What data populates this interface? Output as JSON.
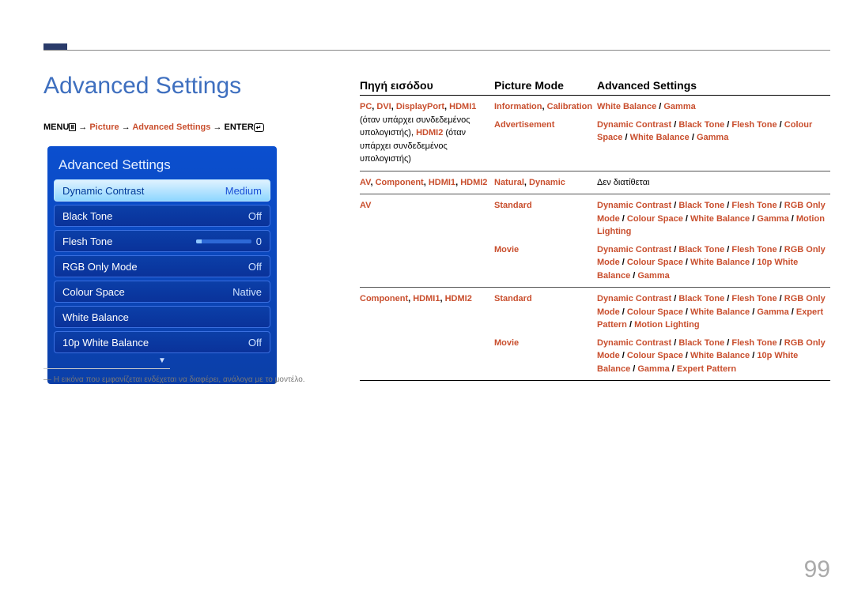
{
  "title": "Advanced Settings",
  "menuPath": {
    "m1": "MENU",
    "p1": "Picture",
    "p2": "Advanced Settings",
    "p3": "ENTER"
  },
  "osd": {
    "title": "Advanced Settings",
    "rows": [
      {
        "label": "Dynamic Contrast",
        "value": "Medium",
        "selected": true
      },
      {
        "label": "Black Tone",
        "value": "Off"
      },
      {
        "label": "Flesh Tone",
        "value": "0",
        "slider": true
      },
      {
        "label": "RGB Only Mode",
        "value": "Off"
      },
      {
        "label": "Colour Space",
        "value": "Native"
      },
      {
        "label": "White Balance",
        "value": ""
      },
      {
        "label": "10p White Balance",
        "value": "Off"
      }
    ]
  },
  "footnote": "― Η εικόνα που εμφανίζεται ενδέχεται να διαφέρει, ανάλογα με το μοντέλο.",
  "tableHead": {
    "c1": "Πηγή εισόδου",
    "c2": "Picture Mode",
    "c3": "Advanced Settings"
  },
  "tableRows": [
    {
      "c1": "<span class='hl'>PC</span><span class='bl'>, </span><span class='hl'>DVI</span><span class='bl'>, </span><span class='hl'>DisplayPort</span><span class='bl'>, </span><span class='hl'>HDMI1</span><span class='nt'> (όταν υπάρχει συνδεδεμένος υπολογιστής), </span><span class='hl'>HDMI2</span><span class='nt'> (όταν υπάρχει συνδεδεμένος υπολογιστής)</span>",
      "sub": [
        {
          "c2": "<span class='hl'>Information</span><span class='bl'>, </span><span class='hl'>Calibration</span>",
          "c3": "<span class='hl'>White Balance</span><span class='bl'> / </span><span class='hl'>Gamma</span>"
        },
        {
          "c2": "<span class='hl'>Advertisement</span>",
          "c3": "<span class='hl'>Dynamic Contrast</span><span class='bl'> / </span><span class='hl'>Black Tone</span><span class='bl'> / </span><span class='hl'>Flesh Tone</span><span class='bl'> / </span><span class='hl'>Colour Space</span><span class='bl'> / </span><span class='hl'>White Balance</span><span class='bl'> / </span><span class='hl'>Gamma</span>"
        }
      ]
    },
    {
      "c1": "<span class='hl'>AV</span><span class='bl'>, </span><span class='hl'>Component</span><span class='bl'>, </span><span class='hl'>HDMI1</span><span class='bl'>, </span><span class='hl'>HDMI2</span>",
      "sub": [
        {
          "c2": "<span class='hl'>Natural</span><span class='bl'>, </span><span class='hl'>Dynamic</span>",
          "c3": "<span class='nt'>Δεν διατίθεται</span>"
        }
      ]
    },
    {
      "c1": "<span class='hl'>AV</span>",
      "sub": [
        {
          "c2": "<span class='hl'>Standard</span>",
          "c3": "<span class='hl'>Dynamic Contrast</span><span class='bl'> / </span><span class='hl'>Black Tone</span><span class='bl'> / </span><span class='hl'>Flesh Tone</span><span class='bl'> / </span><span class='hl'>RGB Only Mode</span><span class='bl'> / </span><span class='hl'>Colour Space</span><span class='bl'> / </span><span class='hl'>White Balance</span><span class='bl'> / </span><span class='hl'>Gamma</span><span class='bl'> / </span><span class='hl'>Motion Lighting</span>"
        },
        {
          "c2": "<span class='hl'>Movie</span>",
          "c3": "<span class='hl'>Dynamic Contrast</span><span class='bl'> / </span><span class='hl'>Black Tone</span><span class='bl'> / </span><span class='hl'>Flesh Tone</span><span class='bl'> / </span><span class='hl'>RGB Only Mode</span><span class='bl'> / </span><span class='hl'>Colour Space</span><span class='bl'> / </span><span class='hl'>White Balance</span><span class='bl'> / </span><span class='hl'>10p White Balance</span><span class='bl'> / </span><span class='hl'>Gamma</span>"
        }
      ]
    },
    {
      "c1": "<span class='hl'>Component</span><span class='bl'>, </span><span class='hl'>HDMI1</span><span class='bl'>, </span><span class='hl'>HDMI2</span>",
      "sub": [
        {
          "c2": "<span class='hl'>Standard</span>",
          "c3": "<span class='hl'>Dynamic Contrast</span><span class='bl'> / </span><span class='hl'>Black Tone</span><span class='bl'> / </span><span class='hl'>Flesh Tone</span><span class='bl'> / </span><span class='hl'>RGB Only Mode</span><span class='bl'> / </span><span class='hl'>Colour Space</span><span class='bl'> / </span><span class='hl'>White Balance</span><span class='bl'> / </span><span class='hl'>Gamma</span><span class='bl'> / </span><span class='hl'>Expert Pattern</span><span class='bl'> / </span><span class='hl'>Motion Lighting</span>"
        },
        {
          "c2": "<span class='hl'>Movie</span>",
          "c3": "<span class='hl'>Dynamic Contrast</span><span class='bl'> / </span><span class='hl'>Black Tone</span><span class='bl'> / </span><span class='hl'>Flesh Tone</span><span class='bl'> / </span><span class='hl'>RGB Only Mode</span><span class='bl'> / </span><span class='hl'>Colour Space</span><span class='bl'> / </span><span class='hl'>White Balance</span><span class='bl'> / </span><span class='hl'>10p White Balance</span><span class='bl'> / </span><span class='hl'>Gamma</span><span class='bl'> / </span><span class='hl'>Expert Pattern</span>"
        }
      ]
    }
  ],
  "pageNumber": "99"
}
